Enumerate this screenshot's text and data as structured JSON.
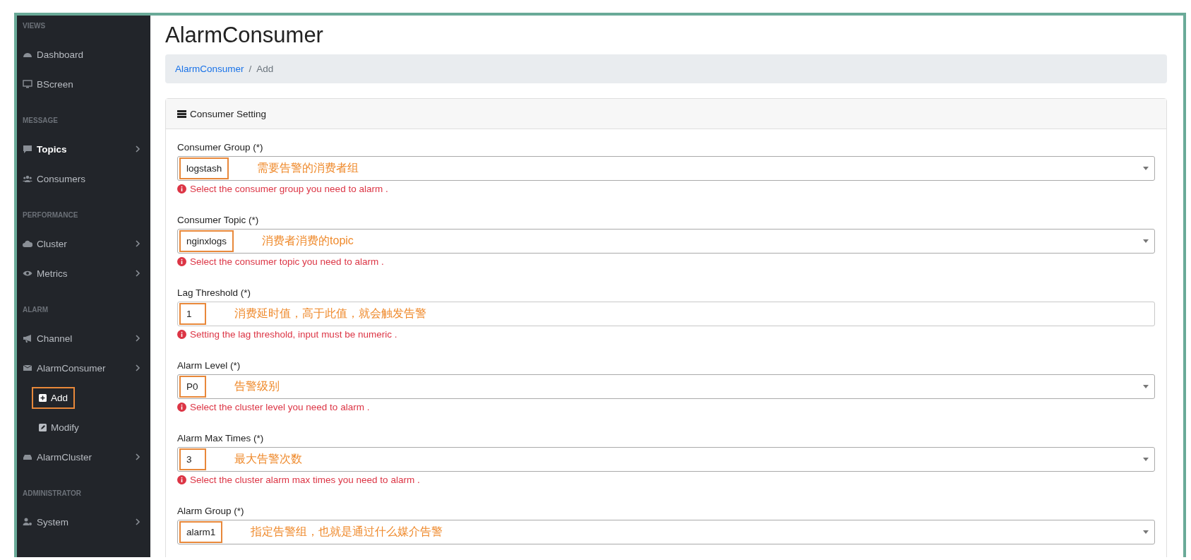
{
  "sidebar": {
    "sections": [
      {
        "heading": "VIEWS",
        "items": [
          {
            "label": "Dashboard",
            "submenu": false,
            "selected": false
          },
          {
            "label": "BScreen",
            "submenu": false,
            "selected": false
          }
        ]
      },
      {
        "heading": "MESSAGE",
        "items": [
          {
            "label": "Topics",
            "submenu": true,
            "selected": true
          },
          {
            "label": "Consumers",
            "submenu": false,
            "selected": false
          }
        ]
      },
      {
        "heading": "PERFORMANCE",
        "items": [
          {
            "label": "Cluster",
            "submenu": true,
            "selected": false
          },
          {
            "label": "Metrics",
            "submenu": true,
            "selected": false
          }
        ]
      },
      {
        "heading": "ALARM",
        "items": [
          {
            "label": "Channel",
            "submenu": true,
            "selected": false
          },
          {
            "label": "AlarmConsumer",
            "submenu": true,
            "selected": false,
            "children": [
              {
                "label": "Add",
                "selected": true,
                "highlighted": true
              },
              {
                "label": "Modify",
                "selected": false,
                "highlighted": false
              }
            ]
          },
          {
            "label": "AlarmCluster",
            "submenu": true,
            "selected": false
          }
        ]
      },
      {
        "heading": "ADMINISTRATOR",
        "items": [
          {
            "label": "System",
            "submenu": true,
            "selected": false
          }
        ]
      }
    ]
  },
  "page": {
    "title": "AlarmConsumer",
    "breadcrumb_separator": "/",
    "breadcrumb": [
      {
        "label": "AlarmConsumer",
        "kind": "link"
      },
      {
        "label": "Add",
        "kind": "current"
      }
    ]
  },
  "card": {
    "title": "Consumer Setting",
    "fields": [
      {
        "label": "Consumer Group (*)",
        "kind": "select",
        "value": "logstash",
        "highlighted": true,
        "note": "需要告警的消费者组",
        "help": "Select the consumer group you need to alarm ."
      },
      {
        "label": "Consumer Topic (*)",
        "kind": "select",
        "value": "nginxlogs",
        "highlighted": true,
        "note": "消费者消费的topic",
        "help": "Select the consumer topic you need to alarm ."
      },
      {
        "label": "Lag Threshold (*)",
        "kind": "input",
        "value": "1",
        "highlighted": true,
        "note": "消费延时值，高于此值，就会触发告警",
        "help": "Setting the lag threshold, input must be numeric ."
      },
      {
        "label": "Alarm Level (*)",
        "kind": "select",
        "value": "P0",
        "highlighted": true,
        "note": "告警级别",
        "help": "Select the cluster level you need to alarm ."
      },
      {
        "label": "Alarm Max Times (*)",
        "kind": "select",
        "value": "3",
        "highlighted": true,
        "note": "最大告警次数",
        "help": "Select the cluster alarm max times you need to alarm ."
      },
      {
        "label": "Alarm Group (*)",
        "kind": "select",
        "value": "alarm1",
        "highlighted": true,
        "note": "指定告警组，也就是通过什么媒介告警"
      }
    ]
  }
}
